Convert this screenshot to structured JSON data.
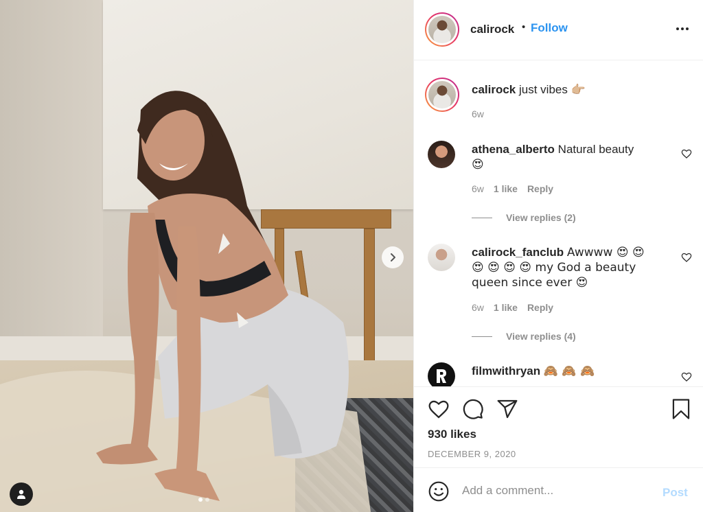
{
  "post": {
    "icons": {
      "next": "chevron-right-icon",
      "user_tags": "user-icon"
    },
    "carousel": {
      "count": 2,
      "active": 1
    }
  },
  "header": {
    "username": "calirock",
    "separator": "•",
    "follow_label": "Follow",
    "more_icon": "more-horizontal-icon"
  },
  "caption": {
    "username": "calirock",
    "text": "just vibes",
    "emoji": "👉🏼",
    "time": "6w"
  },
  "comments": [
    {
      "username": "athena_alberto",
      "text": "Natural beauty",
      "emoji_line2": "😍",
      "time": "6w",
      "likes": "1 like",
      "reply_label": "Reply",
      "view_replies": "View replies (2)"
    },
    {
      "username": "calirock_fanclub",
      "text_line1": "Awwww 😍 😍",
      "text_line2": "😍 😍 😍 😍 my God a beauty",
      "text_line3": "queen since ever 😍",
      "time": "6w",
      "likes": "1 like",
      "reply_label": "Reply",
      "view_replies": "View replies (4)"
    },
    {
      "username": "filmwithryan",
      "text": "🙈 🙈 🙈"
    }
  ],
  "actions": {
    "icons": [
      "heart-icon",
      "comment-icon",
      "share-icon",
      "bookmark-icon"
    ],
    "likes": "930 likes",
    "date": "DECEMBER 9, 2020"
  },
  "add_comment": {
    "placeholder": "Add a comment...",
    "post_label": "Post",
    "emoji_icon": "smiley-icon"
  },
  "colors": {
    "accent_blue": "#2b93f0",
    "post_disabled": "#b3dbff",
    "muted_text": "#8e8e8e",
    "primary_text": "#262626"
  }
}
